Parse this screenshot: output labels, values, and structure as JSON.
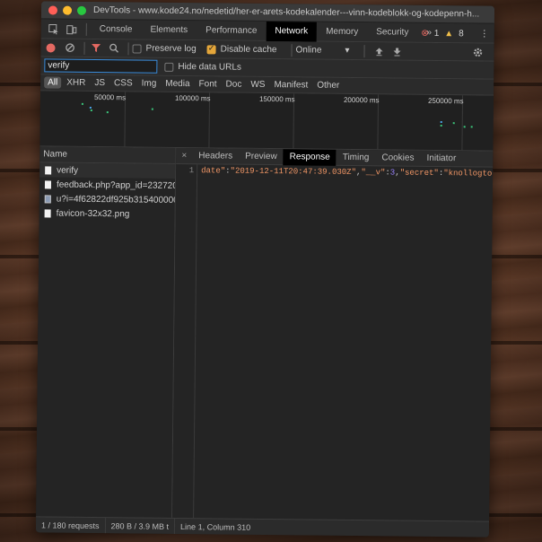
{
  "window": {
    "title": "DevTools - www.kode24.no/nedetid/her-er-arets-kodekalender---vinn-kodeblokk-og-kodepenn-h..."
  },
  "tabs": [
    "Console",
    "Elements",
    "Performance",
    "Network",
    "Memory",
    "Security"
  ],
  "tabs_more": "»",
  "active_tab": "Network",
  "status": {
    "errors": "1",
    "warnings": "8"
  },
  "toolbar": {
    "preserve_log": "Preserve log",
    "disable_cache": "Disable cache",
    "throttle": "Online",
    "preserve_log_checked": false,
    "disable_cache_checked": true
  },
  "filter": {
    "value": "verify",
    "hide_data_urls": "Hide data URLs"
  },
  "types": [
    "All",
    "XHR",
    "JS",
    "CSS",
    "Img",
    "Media",
    "Font",
    "Doc",
    "WS",
    "Manifest",
    "Other"
  ],
  "overview": {
    "ticks": [
      "50000 ms",
      "100000 ms",
      "150000 ms",
      "200000 ms",
      "250000 ms"
    ]
  },
  "name_column": "Name",
  "requests": [
    {
      "name": "verify",
      "type": "doc"
    },
    {
      "name": "feedback.php?app_id=232720...",
      "type": "doc"
    },
    {
      "name": "u?i=4f62822df925b315400000...",
      "type": "img"
    },
    {
      "name": "favicon-32x32.png",
      "type": "doc"
    }
  ],
  "detail_tabs": [
    "Headers",
    "Preview",
    "Response",
    "Timing",
    "Cookies",
    "Initiator"
  ],
  "active_detail_tab": "Response",
  "response": {
    "line_number": "1",
    "key_date": "date\"",
    "val_date": "\"2019-12-11T20:47:39.030Z\"",
    "key_v": "\"__v\"",
    "val_v": "3",
    "key_secret": "\"secret\"",
    "val_secret": "\"knollogtott\""
  },
  "statusbar": {
    "requests": "1 / 180 requests",
    "transferred": "280 B / 3.9 MB t",
    "cursor": "Line 1, Column 310"
  },
  "colors": {
    "accent": "#3a8cdb",
    "error": "#e46962",
    "warning": "#f2c04a"
  }
}
